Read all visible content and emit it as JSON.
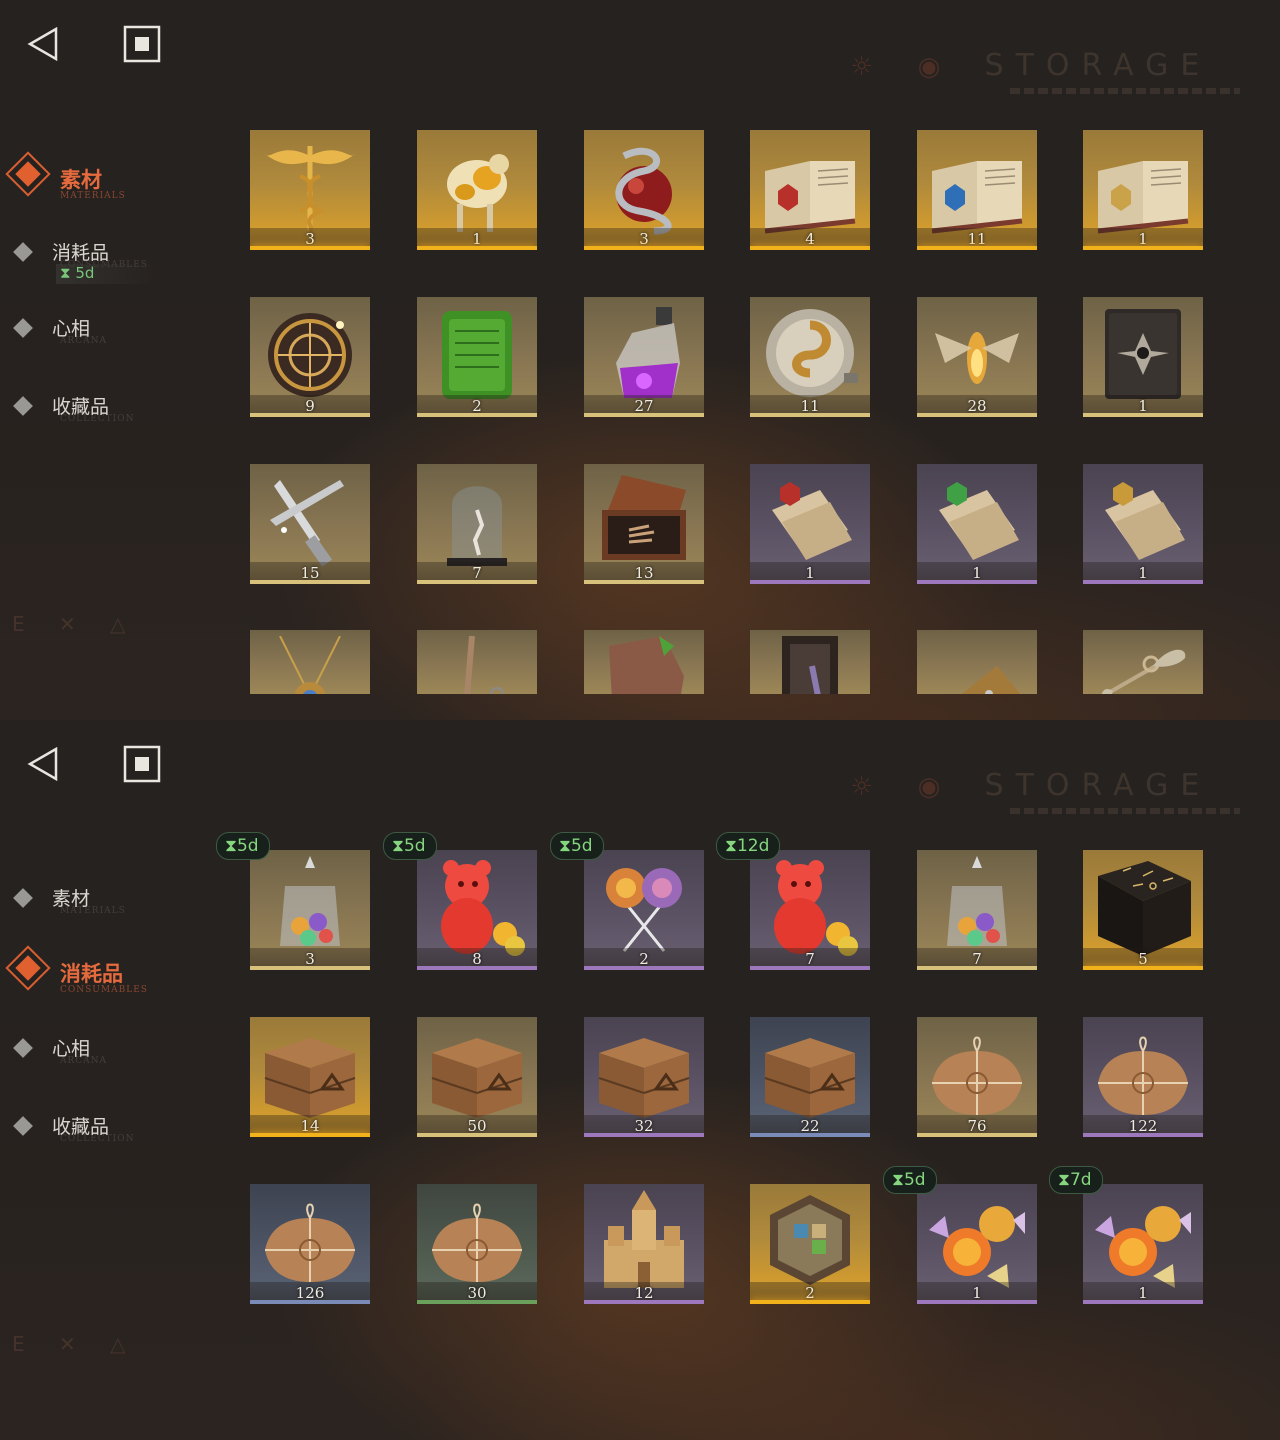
{
  "watermark": {
    "text": "STORAGE"
  },
  "sidebar_glyphs": "E ✕ △",
  "panels": [
    {
      "categories": [
        {
          "label": "素材",
          "sub": "MATERIALS",
          "active": true
        },
        {
          "label": "消耗品",
          "sub": "CONSUMABLES",
          "active": false,
          "timer": "5d"
        },
        {
          "label": "心相",
          "sub": "ARCANA",
          "active": false
        },
        {
          "label": "收藏品",
          "sub": "COLLECTION",
          "active": false
        }
      ],
      "items": [
        {
          "name": "caduceus",
          "count": "3",
          "rarity": "gold"
        },
        {
          "name": "gilded-sheep",
          "count": "1",
          "rarity": "gold"
        },
        {
          "name": "serpent-apple",
          "count": "3",
          "rarity": "gold"
        },
        {
          "name": "book-red-gem",
          "count": "4",
          "rarity": "gold"
        },
        {
          "name": "book-blue-gem",
          "count": "11",
          "rarity": "gold"
        },
        {
          "name": "book-gold-gem",
          "count": "1",
          "rarity": "gold"
        },
        {
          "name": "astrolabe",
          "count": "9",
          "rarity": "goldfade"
        },
        {
          "name": "green-tablet",
          "count": "2",
          "rarity": "goldfade"
        },
        {
          "name": "purple-potion",
          "count": "27",
          "rarity": "goldfade"
        },
        {
          "name": "coin-device",
          "count": "11",
          "rarity": "goldfade"
        },
        {
          "name": "glow-moth",
          "count": "28",
          "rarity": "goldfade"
        },
        {
          "name": "dark-tome",
          "count": "1",
          "rarity": "goldfade"
        },
        {
          "name": "silver-blades",
          "count": "15",
          "rarity": "goldfade"
        },
        {
          "name": "bell-jar",
          "count": "7",
          "rarity": "goldfade"
        },
        {
          "name": "hand-box",
          "count": "13",
          "rarity": "goldfade"
        },
        {
          "name": "scroll-red",
          "count": "1",
          "rarity": "purple"
        },
        {
          "name": "scroll-green",
          "count": "1",
          "rarity": "purple"
        },
        {
          "name": "scroll-gold",
          "count": "1",
          "rarity": "purple"
        },
        {
          "name": "pendant",
          "count": "",
          "rarity": "goldfade"
        },
        {
          "name": "chain-charm",
          "count": "",
          "rarity": "goldfade"
        },
        {
          "name": "stone-fragment",
          "count": "",
          "rarity": "goldfade"
        },
        {
          "name": "dark-frame",
          "count": "",
          "rarity": "goldfade"
        },
        {
          "name": "brass-device",
          "count": "",
          "rarity": "goldfade"
        },
        {
          "name": "winged-key",
          "count": "",
          "rarity": "goldfade"
        }
      ]
    },
    {
      "categories": [
        {
          "label": "素材",
          "sub": "MATERIALS",
          "active": false
        },
        {
          "label": "消耗品",
          "sub": "CONSUMABLES",
          "active": true
        },
        {
          "label": "心相",
          "sub": "ARCANA",
          "active": false
        },
        {
          "label": "收藏品",
          "sub": "COLLECTION",
          "active": false
        }
      ],
      "items": [
        {
          "name": "candy-jar",
          "count": "3",
          "rarity": "goldfade",
          "timer": "5d"
        },
        {
          "name": "gummy-bear",
          "count": "8",
          "rarity": "purple",
          "timer": "5d"
        },
        {
          "name": "lollipops",
          "count": "2",
          "rarity": "purple",
          "timer": "5d"
        },
        {
          "name": "gummy-bear",
          "count": "7",
          "rarity": "purple",
          "timer": "12d"
        },
        {
          "name": "candy-jar",
          "count": "7",
          "rarity": "goldfade"
        },
        {
          "name": "rune-chest",
          "count": "5",
          "rarity": "gold"
        },
        {
          "name": "crate",
          "count": "14",
          "rarity": "gold"
        },
        {
          "name": "crate",
          "count": "50",
          "rarity": "goldfade"
        },
        {
          "name": "crate",
          "count": "32",
          "rarity": "purple"
        },
        {
          "name": "crate",
          "count": "22",
          "rarity": "blue"
        },
        {
          "name": "parcel",
          "count": "76",
          "rarity": "goldfade"
        },
        {
          "name": "parcel",
          "count": "122",
          "rarity": "purple"
        },
        {
          "name": "parcel",
          "count": "126",
          "rarity": "blue"
        },
        {
          "name": "parcel",
          "count": "30",
          "rarity": "green"
        },
        {
          "name": "sand-castle",
          "count": "12",
          "rarity": "purple"
        },
        {
          "name": "hex-token",
          "count": "2",
          "rarity": "gold"
        },
        {
          "name": "wrapped-candies",
          "count": "1",
          "rarity": "purple",
          "timer": "5d"
        },
        {
          "name": "wrapped-candies",
          "count": "1",
          "rarity": "purple",
          "timer": "7d"
        }
      ]
    }
  ]
}
